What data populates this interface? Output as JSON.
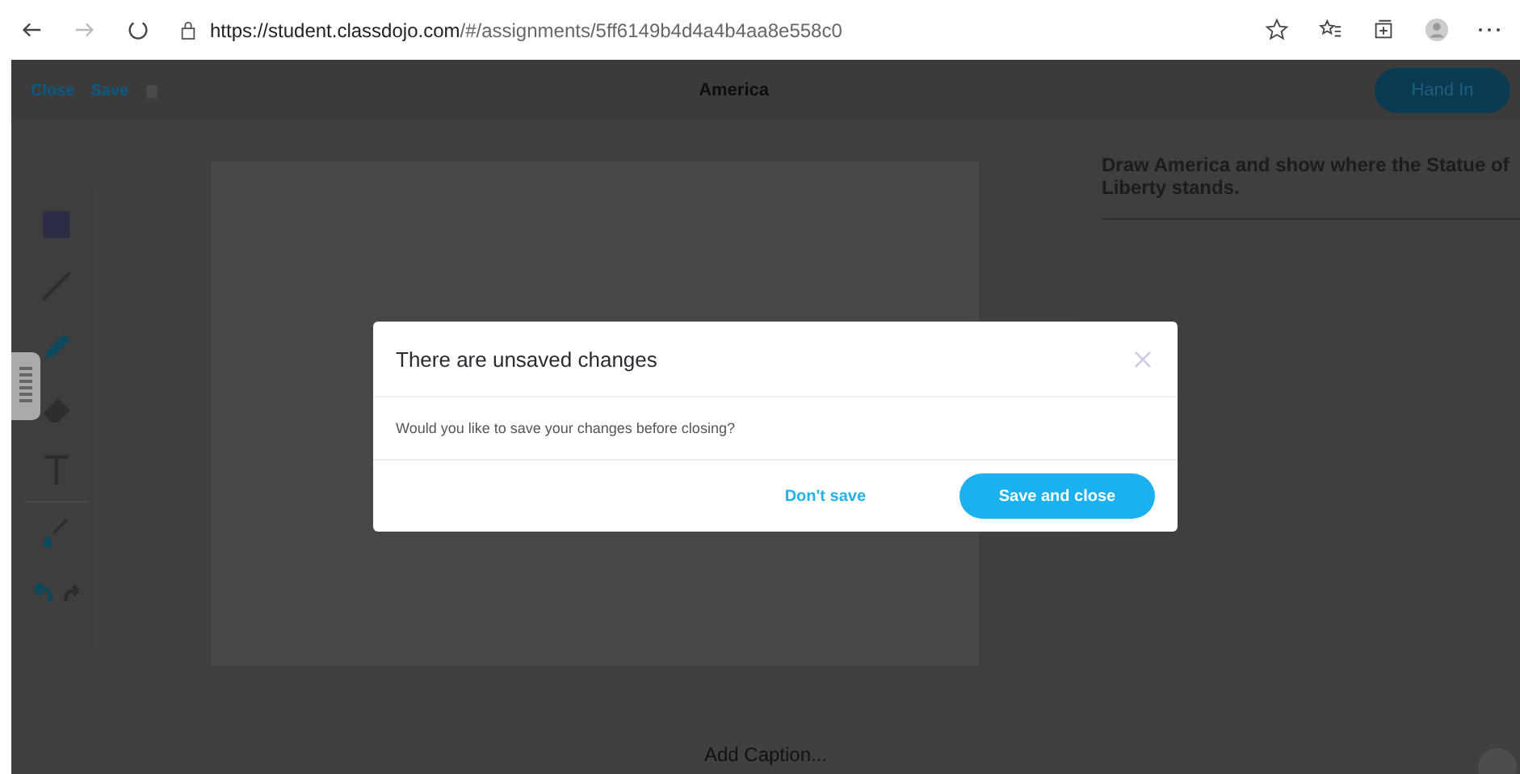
{
  "browser": {
    "url_host": "https://student.classdojo.com",
    "url_path": "/#/assignments/5ff6149b4d4a4b4aa8e558c0"
  },
  "toolbar": {
    "close": "Close",
    "save": "Save",
    "title": "America",
    "hand_in": "Hand In"
  },
  "tools": [
    {
      "kind": "square",
      "selected": false
    },
    {
      "kind": "line",
      "selected": false
    },
    {
      "kind": "pencil",
      "selected": true
    },
    {
      "kind": "eraser",
      "selected": false
    },
    {
      "kind": "text",
      "selected": false
    },
    {
      "kind": "color",
      "selected": false
    },
    {
      "kind": "undo",
      "selected": false
    }
  ],
  "instructions": "Draw America and show where the Statue of Liberty stands.",
  "caption": {
    "placeholder": "Add Caption..."
  },
  "dialog": {
    "title": "There are unsaved changes",
    "message": "Would you like to save your changes before closing?",
    "secondary": "Don't save",
    "primary": "Save and close"
  }
}
